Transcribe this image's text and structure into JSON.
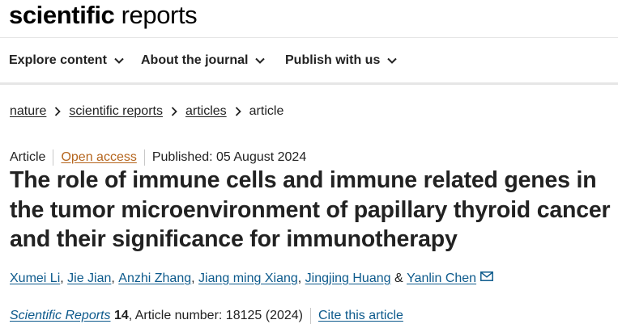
{
  "site": {
    "logo_bold": "scientific",
    "logo_light": " reports"
  },
  "nav": {
    "items": [
      {
        "label": "Explore content"
      },
      {
        "label": "About the journal"
      },
      {
        "label": "Publish with us"
      }
    ]
  },
  "breadcrumb": {
    "items": [
      "nature",
      "scientific reports",
      "articles",
      "article"
    ]
  },
  "article": {
    "type": "Article",
    "access": "Open access",
    "published": "Published: 05 August 2024",
    "title": "The role of immune cells and immune related genes in the tumor microenvironment of papillary thyroid cancer and their significance for immunotherapy",
    "authors": [
      "Xumei Li",
      "Jie Jian",
      "Anzhi Zhang",
      "Jiang ming Xiang",
      "Jingjing Huang",
      "Yanlin Chen"
    ],
    "author_sep": ", ",
    "author_and": " & ",
    "journal": "Scientific Reports",
    "volume": "14",
    "article_number": ", Article number: 18125 (2024)",
    "cite_label": "Cite this article"
  },
  "colors": {
    "link": "#0d5a8c",
    "open_access": "#b5651d",
    "text": "#222222"
  }
}
